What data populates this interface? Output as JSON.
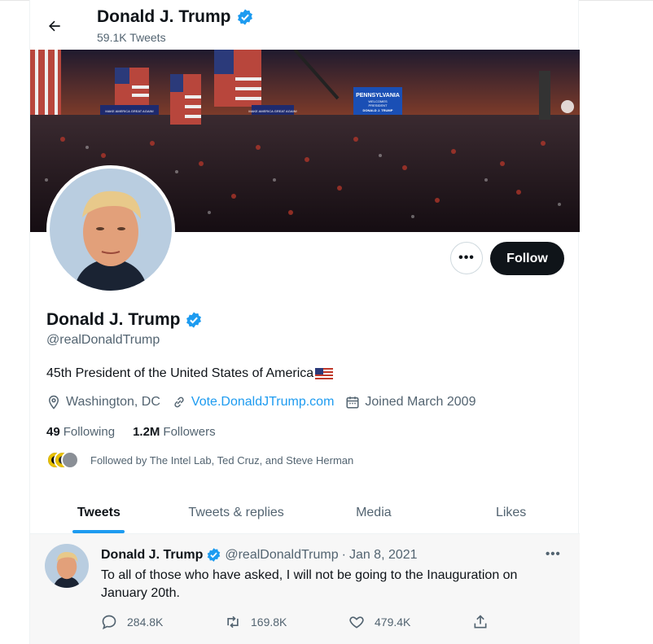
{
  "header": {
    "name": "Donald J. Trump",
    "tweet_count": "59.1K Tweets"
  },
  "banner": {
    "sign_main": "PENNSYLVANIA",
    "sign_sub1": "WELCOMES",
    "sign_sub2": "PRESIDENT",
    "sign_sub3": "DONALD J. TRUMP",
    "banner_left": "MAKE AMERICA GREAT AGAIN!",
    "banner_right": "MAKE AMERICA GREAT AGAIN!"
  },
  "actions": {
    "more": "•••",
    "follow": "Follow"
  },
  "profile": {
    "name": "Donald J. Trump",
    "handle": "@realDonaldTrump",
    "bio": "45th President of the United States of America",
    "location": "Washington, DC",
    "website": "Vote.DonaldJTrump.com",
    "joined": "Joined March 2009",
    "following_count": "49",
    "following_label": "Following",
    "followers_count": "1.2M",
    "followers_label": "Followers",
    "followed_by": "Followed by The Intel Lab, Ted Cruz, and Steve Herman"
  },
  "tabs": [
    {
      "label": "Tweets"
    },
    {
      "label": "Tweets & replies"
    },
    {
      "label": "Media"
    },
    {
      "label": "Likes"
    }
  ],
  "tweet": {
    "name": "Donald J. Trump",
    "handle": "@realDonaldTrump",
    "separator": "·",
    "date": "Jan 8, 2021",
    "more": "•••",
    "text": "To all of those who have asked, I will not be going to the Inauguration on January 20th.",
    "replies": "284.8K",
    "retweets": "169.8K",
    "likes": "479.4K"
  },
  "colors": {
    "accent": "#1d9bf0",
    "text": "#0f1419",
    "muted": "#536471",
    "follow_bg": "#0f1419"
  }
}
